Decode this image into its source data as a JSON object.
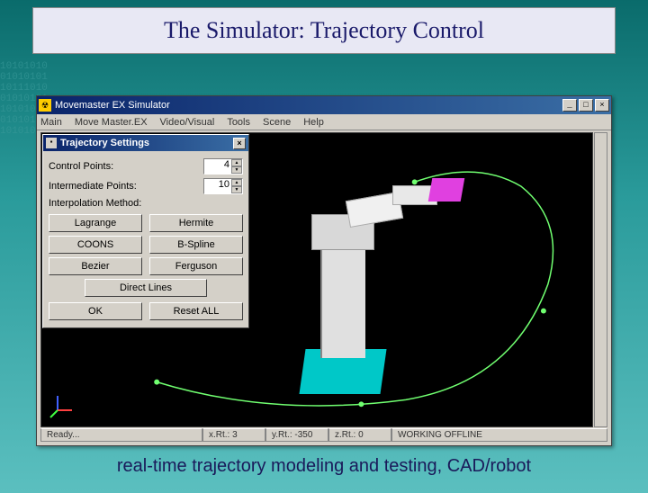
{
  "slide": {
    "title": "The Simulator: Trajectory Control",
    "caption": "real-time trajectory modeling and testing, CAD/robot"
  },
  "app": {
    "title": "Movemaster EX Simulator",
    "menus": [
      "Main",
      "Move Master.EX",
      "Video/Visual",
      "Tools",
      "Scene",
      "Help"
    ]
  },
  "statusbar": {
    "ready": "Ready...",
    "x": "x.Rt.: 3",
    "y": "y.Rt.: -350",
    "z": "z.Rt.: 0",
    "mode": "WORKING OFFLINE"
  },
  "dialog": {
    "title": "Trajectory Settings",
    "fields": {
      "control_points_label": "Control Points:",
      "control_points_value": "4",
      "intermediate_points_label": "Intermediate Points:",
      "intermediate_points_value": "10",
      "interp_label": "Interpolation Method:"
    },
    "methods": {
      "lagrange": "Lagrange",
      "hermite": "Hermite",
      "coons": "COONS",
      "bspline": "B-Spline",
      "bezier": "Bezier",
      "ferguson": "Ferguson",
      "direct": "Direct Lines"
    },
    "actions": {
      "ok": "OK",
      "reset": "Reset ALL"
    }
  },
  "colors": {
    "eef": "#e040e0",
    "base": "#00c8c8",
    "trajectory": "#70ff70"
  }
}
